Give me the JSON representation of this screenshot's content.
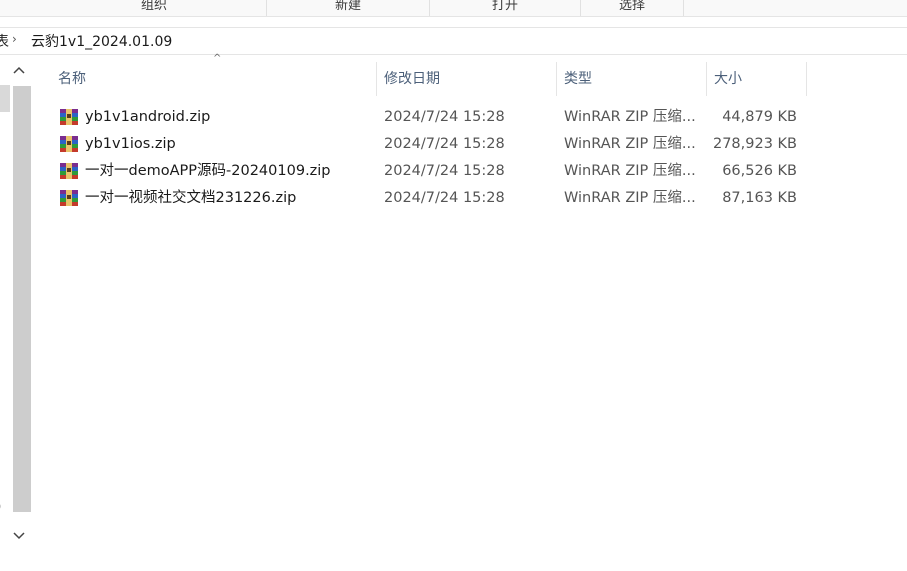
{
  "ribbon": {
    "groups": [
      {
        "label": "组织"
      },
      {
        "label": "新建"
      },
      {
        "label": "打开"
      },
      {
        "label": "选择"
      }
    ]
  },
  "address": {
    "previous_partial": "表",
    "separator": "›",
    "current": "云豹1v1_2024.01.09"
  },
  "nav": {
    "up_icon": "chevron-up-icon",
    "down_icon": "chevron-down-icon",
    "partial_label": ")"
  },
  "columns": {
    "name": "名称",
    "date": "修改日期",
    "type": "类型",
    "size": "大小",
    "sort_indicator": "^"
  },
  "files": [
    {
      "name": "yb1v1android.zip",
      "date": "2024/7/24 15:28",
      "type": "WinRAR ZIP 压缩...",
      "size": "44,879 KB",
      "icon": "winrar-zip-icon"
    },
    {
      "name": "yb1v1ios.zip",
      "date": "2024/7/24 15:28",
      "type": "WinRAR ZIP 压缩...",
      "size": "278,923 KB",
      "icon": "winrar-zip-icon"
    },
    {
      "name": "一对一demoAPP源码-20240109.zip",
      "date": "2024/7/24 15:28",
      "type": "WinRAR ZIP 压缩...",
      "size": "66,526 KB",
      "icon": "winrar-zip-icon"
    },
    {
      "name": "一对一视频社交文档231226.zip",
      "date": "2024/7/24 15:28",
      "type": "WinRAR ZIP 压缩...",
      "size": "87,163 KB",
      "icon": "winrar-zip-icon"
    }
  ]
}
